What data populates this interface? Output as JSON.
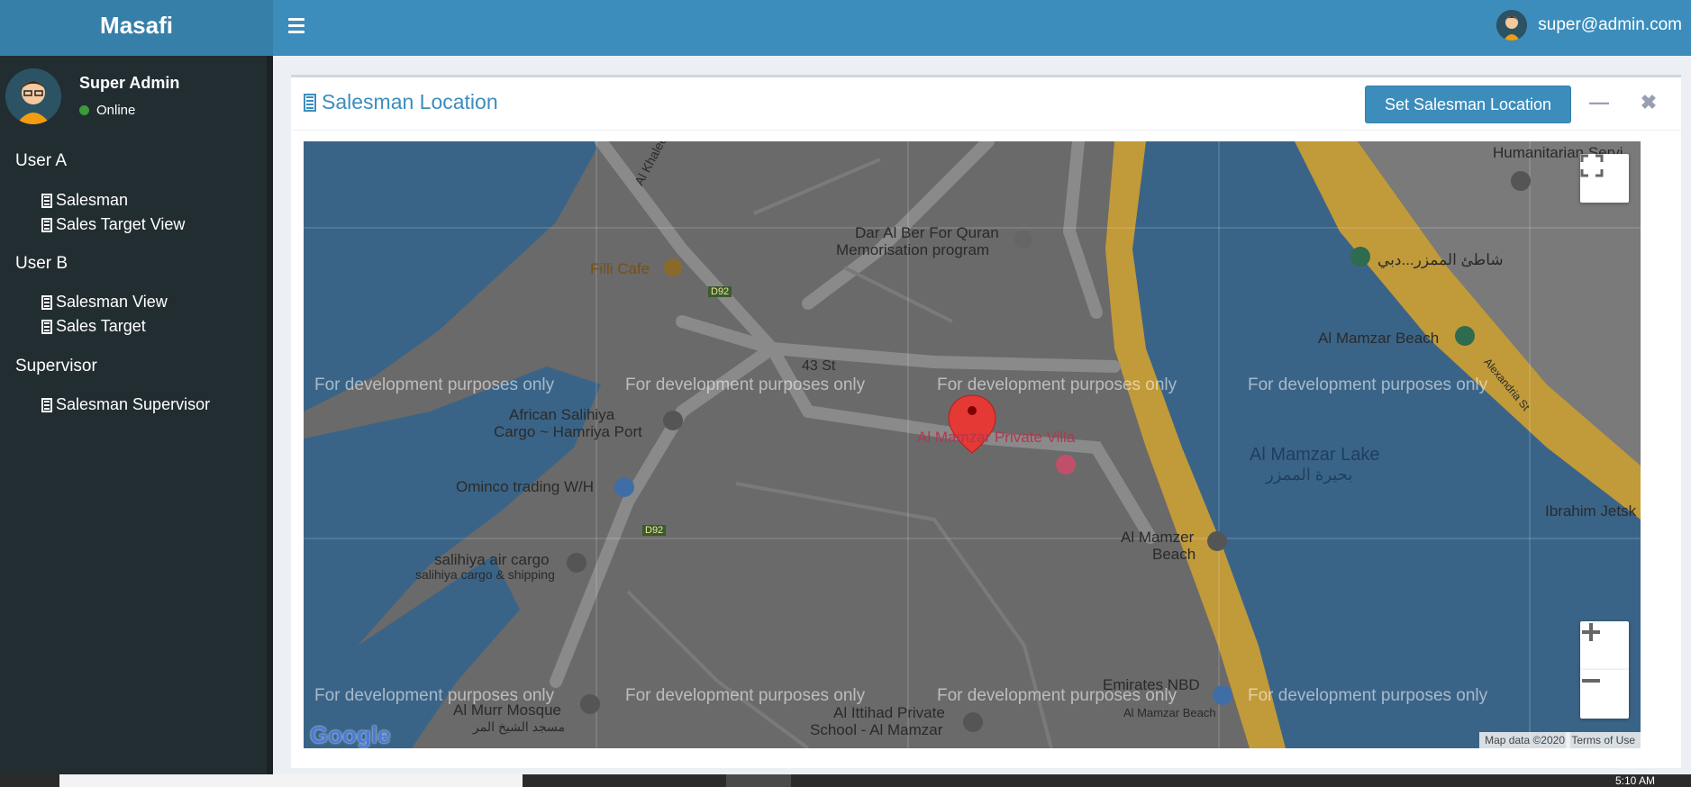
{
  "brand": "Masafi",
  "header": {
    "user_email": "super@admin.com"
  },
  "sidebar": {
    "user_name": "Super Admin",
    "status": "Online",
    "sections": [
      {
        "title": "User A",
        "items": [
          "Salesman",
          "Sales Target View"
        ]
      },
      {
        "title": "User B",
        "items": [
          "Salesman View",
          "Sales Target"
        ]
      },
      {
        "title": "Supervisor",
        "items": [
          "Salesman Supervisor"
        ]
      }
    ]
  },
  "box": {
    "title": "Salesman Location",
    "primary_button": "Set Salesman Location",
    "minimize_icon": "minus-icon",
    "close_icon": "close-icon"
  },
  "map": {
    "watermark": "For development purposes only",
    "labels": {
      "filli_cafe": "Filli Cafe",
      "dar_al_ber": "Dar Al Ber For Quran",
      "dar_al_ber_2": "Memorisation program",
      "st43": "43 St",
      "african": "African Salihiya",
      "african_2": "Cargo ~ Hamriya Port",
      "villa": "Al Mamzar Private Villa",
      "omninco": "Ominco trading W/H",
      "salihiya": "salihiya air cargo",
      "salihiya_2": "salihiya cargo & shipping",
      "mamzar_beach": "Al Mamzar Beach",
      "mamzar_lake": "Al Mamzar Lake",
      "mamzar_lake_ar": "بحيرة الممزر",
      "shati_ar": "شاطئ الممزر...دبي",
      "humanitarian": "Humanitarian Servi",
      "mamzer_beach2": "Al Mamzer",
      "mamzer_beach2b": "Beach",
      "ibrahim": "Ibrahim Jetsk",
      "emirates_nbd": "Emirates NBD",
      "emirates_nbd_2": "Al Mamzar Beach",
      "ittihad": "Al Ittihad Private",
      "ittihad_2": "School - Al Mamzar",
      "murr": "Al Murr Mosque",
      "murr_ar": "مسجد الشيخ المر",
      "khaleej": "Al Khaleej Ro",
      "d92": "D92",
      "alexandria": "Alexandria St"
    },
    "attribution": "Map data ©2020",
    "terms": "Terms of Use",
    "google": "Google"
  },
  "taskbar": {
    "clock": "5:10 AM"
  },
  "colors": {
    "header": "#3c8dbc",
    "brand_bg": "#367fa9",
    "sidebar": "#222d32",
    "water": "#3a6487",
    "sand": "#c19a3a",
    "marker": "#e53935"
  }
}
